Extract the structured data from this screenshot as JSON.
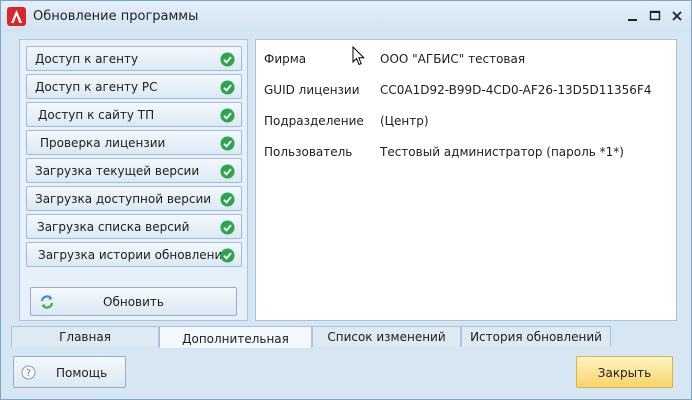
{
  "window": {
    "title": "Обновление программы",
    "controls": {
      "minimize": "minimize-icon",
      "maximize": "maximize-icon",
      "close": "close-icon"
    }
  },
  "checks": [
    {
      "label": "Доступ к агенту",
      "status": "ok"
    },
    {
      "label": "Доступ к агенту РС",
      "status": "ok"
    },
    {
      "label": "Доступ к сайту ТП",
      "status": "ok"
    },
    {
      "label": "Проверка лицензии",
      "status": "ok"
    },
    {
      "label": "Загрузка текущей версии",
      "status": "ok"
    },
    {
      "label": "Загрузка доступной версии",
      "status": "ok"
    },
    {
      "label": "Загрузка списка версий",
      "status": "ok"
    },
    {
      "label": "Загрузка истории обновлений",
      "status": "ok"
    }
  ],
  "refresh_button": {
    "label": "Обновить"
  },
  "info": [
    {
      "key": "Фирма",
      "value": "ООО \"АГБИС\" тестовая"
    },
    {
      "key": "GUID лицензии",
      "value": "CC0A1D92-B99D-4CD0-AF26-13D5D11356F4"
    },
    {
      "key": "Подразделение",
      "value": "(Центр)"
    },
    {
      "key": "Пользователь",
      "value": "Тестовый администратор (пароль *1*)"
    }
  ],
  "tabs": [
    {
      "label": "Главная",
      "active": false
    },
    {
      "label": "Дополнительная",
      "active": true
    },
    {
      "label": "Список изменений",
      "active": false
    },
    {
      "label": "История обновлений",
      "active": false
    }
  ],
  "footer": {
    "help_label": "Помощь",
    "close_label": "Закрыть"
  },
  "colors": {
    "accent": "#f8d46a",
    "ok": "#2ea44f",
    "frame": "#d6e6f2"
  }
}
